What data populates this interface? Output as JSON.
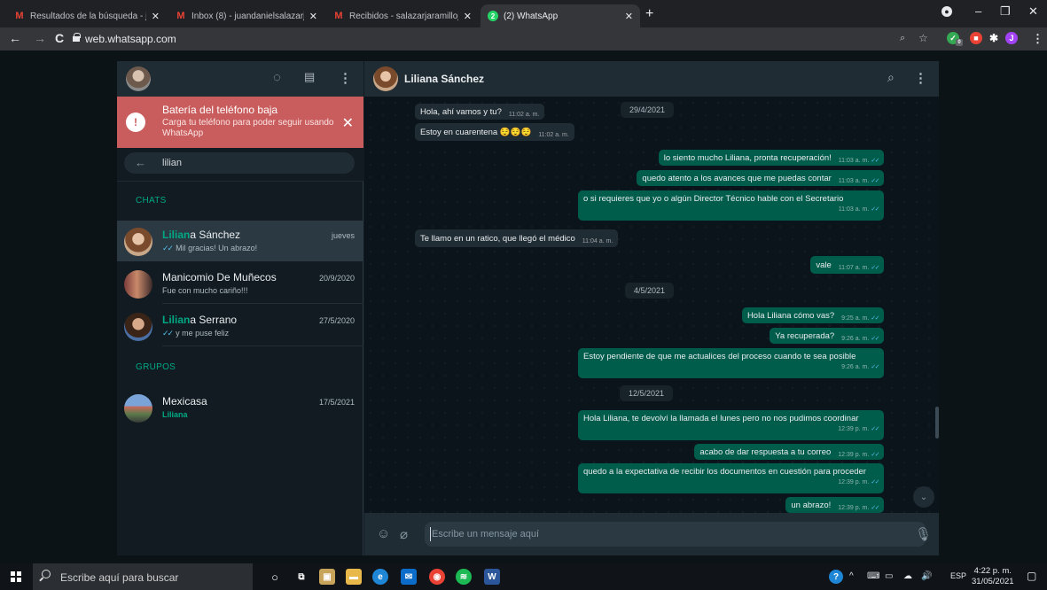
{
  "browser": {
    "tabs": [
      {
        "title": "Resultados de la búsqueda - juan",
        "icon": "gmail-icon",
        "active": false
      },
      {
        "title": "Inbox (8) - juandanielsalazarj@gm",
        "icon": "gmail-icon",
        "active": false
      },
      {
        "title": "Recibidos - salazarjaramillojuand",
        "icon": "gmail-icon",
        "active": false
      },
      {
        "title": "(2) WhatsApp",
        "icon": "whatsapp-icon",
        "active": true,
        "badge": "2"
      }
    ],
    "url": "web.whatsapp.com",
    "window_controls": {
      "minimize": "–",
      "restore": "❐",
      "close": "✕"
    },
    "profile_initial": "J",
    "extension_badge": "0"
  },
  "whatsapp": {
    "battery_alert": {
      "title": "Batería del teléfono baja",
      "text": "Carga tu teléfono para poder seguir usando WhatsApp"
    },
    "search": {
      "value": "lilian"
    },
    "sections": {
      "chats": "CHATS",
      "groups": "GRUPOS"
    },
    "chats": [
      {
        "name_highlight": "Lilian",
        "name_rest": "a Sánchez",
        "preview": "Mil gracias! Un abrazo!",
        "time": "jueves",
        "ticks": "blue",
        "selected": true
      },
      {
        "name": "Manicomio De Muñecos",
        "preview": "Fue con mucho cariño!!!",
        "time": "20/9/2020"
      },
      {
        "name_highlight": "Lilian",
        "name_rest": "a Serrano",
        "preview": "y me puse feliz",
        "time": "27/5/2020",
        "ticks": "blue"
      }
    ],
    "groups": [
      {
        "name": "Mexicasa",
        "preview": "Liliana",
        "time": "17/5/2021"
      }
    ],
    "conversation": {
      "contact_name": "Liliana Sánchez",
      "messages": [
        {
          "dir": "in",
          "text": "Hola, ahí vamos y tu?",
          "time": "11:02 a. m."
        },
        {
          "dir": "date",
          "text": "29/4/2021"
        },
        {
          "dir": "in",
          "text": "Estoy en cuarentena 😌😌😌",
          "time": "11:02 a. m."
        },
        {
          "dir": "out",
          "text": "lo siento mucho Liliana, pronta recuperación!",
          "time": "11:03 a. m."
        },
        {
          "dir": "out",
          "text": "quedo atento a los avances que me puedas contar",
          "time": "11:03 a. m."
        },
        {
          "dir": "out",
          "text": "o si requieres que yo o algún Director Técnico hable con el Secretario",
          "time": "11:03 a. m."
        },
        {
          "dir": "in",
          "text": "Te llamo en un ratico, que llegó el médico",
          "time": "11:04 a. m."
        },
        {
          "dir": "out",
          "text": "vale",
          "time": "11:07 a. m."
        },
        {
          "dir": "date",
          "text": "4/5/2021"
        },
        {
          "dir": "out",
          "text": "Hola Liliana cómo vas?",
          "time": "9:25 a. m."
        },
        {
          "dir": "out",
          "text": "Ya recuperada?",
          "time": "9:26 a. m."
        },
        {
          "dir": "out",
          "text": "Estoy pendiente de que me actualices del proceso cuando te sea posible",
          "time": "9:26 a. m."
        },
        {
          "dir": "date",
          "text": "12/5/2021"
        },
        {
          "dir": "out",
          "text": "Hola Liliana, te devolví la llamada el lunes pero no nos pudimos coordinar",
          "time": "12:39 p. m."
        },
        {
          "dir": "out",
          "text": "acabo de dar respuesta a tu correo",
          "time": "12:39 p. m."
        },
        {
          "dir": "out",
          "text": "quedo a la expectativa de recibir los documentos en cuestión para proceder",
          "time": "12:39 p. m."
        },
        {
          "dir": "out",
          "text": "un abrazo!",
          "time": "12:39 p. m."
        }
      ]
    },
    "composer": {
      "placeholder": "Escribe un mensaje aquí"
    }
  },
  "taskbar": {
    "search_placeholder": "Escribe aquí para buscar",
    "language": "ESP",
    "time": "4:22 p. m.",
    "date": "31/05/2021"
  },
  "colors": {
    "accent": "#00a884",
    "outgoing_bubble": "#005c4b",
    "incoming_bubble": "#202c33",
    "battery_alert": "#c95d5d",
    "read_ticks": "#53bdeb"
  }
}
